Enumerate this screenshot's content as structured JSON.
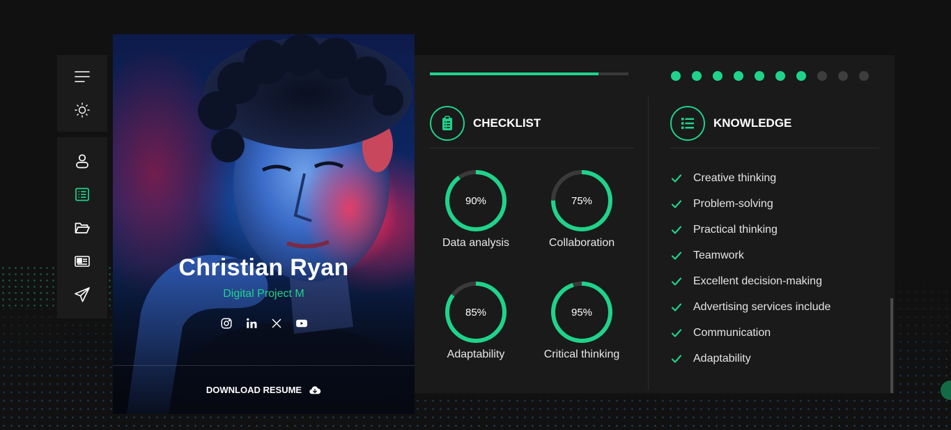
{
  "colors": {
    "accent": "#1fd38a",
    "background": "#111111",
    "panel": "#1a1a1a",
    "inactive": "#3d3d3d"
  },
  "toolbar": {
    "top_items": [
      {
        "icon": "menu-icon"
      },
      {
        "icon": "sun-icon"
      }
    ],
    "nav_items": [
      {
        "icon": "user-icon",
        "active": false
      },
      {
        "icon": "list-icon",
        "active": true
      },
      {
        "icon": "folder-open-icon",
        "active": false
      },
      {
        "icon": "news-icon",
        "active": false
      },
      {
        "icon": "send-icon",
        "active": false
      }
    ]
  },
  "profile": {
    "name": "Christian Ryan",
    "role": "Digital Project M",
    "socials": [
      "instagram-icon",
      "linkedin-icon",
      "x-icon",
      "youtube-icon"
    ],
    "download_label": "DOWNLOAD RESUME",
    "download_icon": "cloud-download-icon"
  },
  "progress": {
    "fraction": 0.85,
    "steps_total": 10,
    "steps_done": 7
  },
  "checklist": {
    "title": "CHECKLIST",
    "icon": "clipboard-icon",
    "skills": [
      {
        "name": "Data analysis",
        "percent": 90,
        "label": "90%"
      },
      {
        "name": "Collaboration",
        "percent": 75,
        "label": "75%"
      },
      {
        "name": "Adaptability",
        "percent": 85,
        "label": "85%"
      },
      {
        "name": "Critical thinking",
        "percent": 95,
        "label": "95%"
      }
    ]
  },
  "knowledge": {
    "title": "KNOWLEDGE",
    "icon": "bullet-list-icon",
    "items": [
      "Creative thinking",
      "Problem-solving",
      "Practical thinking",
      "Teamwork",
      "Excellent decision-making",
      "Advertising services include",
      "Communication",
      "Adaptability"
    ]
  }
}
